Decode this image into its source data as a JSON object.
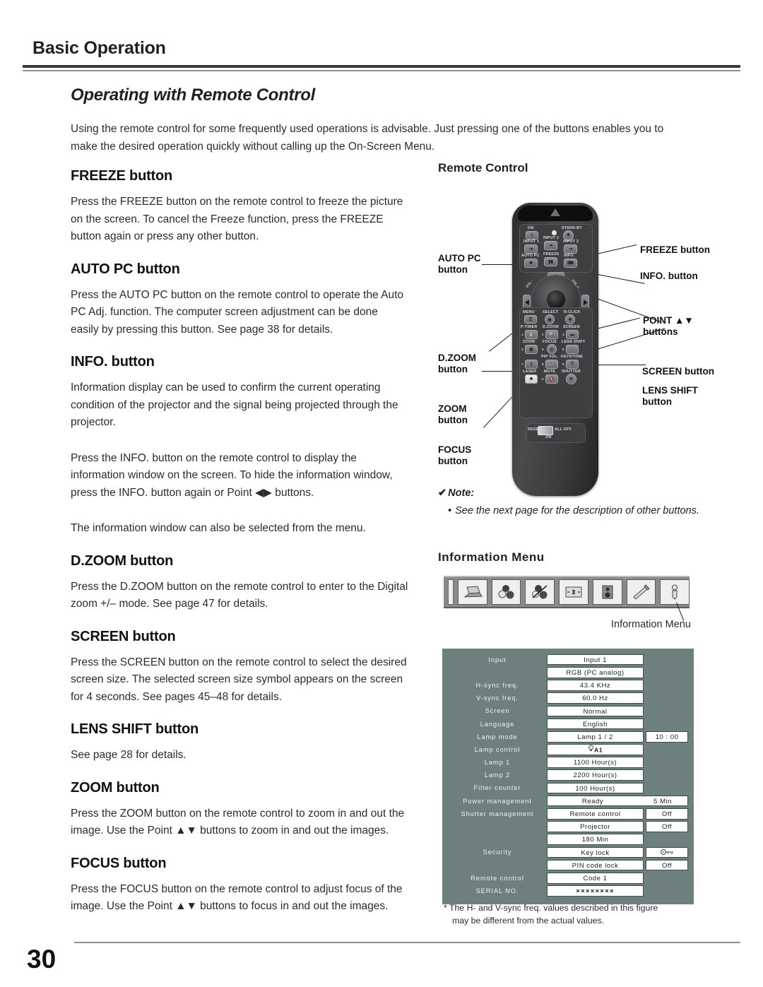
{
  "header": {
    "chapter": "Basic Operation",
    "section_title": "Operating with Remote Control",
    "intro": "Using the remote control for some frequently used operations is advisable. Just pressing one of the buttons enables you to make the desired operation quickly without calling up the On-Screen Menu."
  },
  "left_sections": [
    {
      "heading": "FREEZE button",
      "paragraphs": [
        "Press the FREEZE button on the remote control to freeze the picture on the screen. To cancel the Freeze function, press the FREEZE button again or press any other button."
      ]
    },
    {
      "heading": "AUTO PC button",
      "paragraphs": [
        "Press the AUTO PC button on the remote control to operate the Auto PC Adj. function. The computer screen adjustment can be done easily by pressing this button. See page 38 for details."
      ]
    },
    {
      "heading": "INFO. button",
      "paragraphs": [
        "Information display can be used to confirm the current operating condition of the projector and the signal being projected through the projector.",
        "Press the INFO. button on the remote control to display the information window on the screen. To hide the information window, press the INFO. button again or Point ◀▶ buttons.",
        "The information window can also be selected from the menu."
      ]
    },
    {
      "heading": "D.ZOOM button",
      "paragraphs": [
        "Press the D.ZOOM button on the remote control to enter to the Digital zoom +/– mode. See page 47 for details."
      ]
    },
    {
      "heading": "SCREEN button",
      "paragraphs": [
        "Press the SCREEN button on the remote control to select the desired screen size. The selected screen size symbol appears on the screen for 4 seconds. See pages 45–48 for details."
      ]
    },
    {
      "heading": "LENS SHIFT button",
      "paragraphs": [
        "See page 28 for details."
      ]
    },
    {
      "heading": "ZOOM button",
      "paragraphs": [
        "Press the ZOOM button on the remote control to zoom in and out the image. Use the Point ▲▼ buttons to zoom in and out the images."
      ]
    },
    {
      "heading": "FOCUS button",
      "paragraphs": [
        "Press the FOCUS button on the remote control to adjust focus of the image. Use the Point ▲▼ buttons to focus in and out the images."
      ]
    }
  ],
  "remote": {
    "title": "Remote Control",
    "callouts_left": [
      {
        "name": "auto-pc",
        "line1": "AUTO PC",
        "line2": "button"
      },
      {
        "name": "dzoom",
        "line1": "D.ZOOM",
        "line2": "button"
      },
      {
        "name": "zoom",
        "line1": "ZOOM",
        "line2": "button"
      },
      {
        "name": "focus",
        "line1": "FOCUS",
        "line2": "button"
      }
    ],
    "callouts_right": [
      {
        "name": "freeze",
        "line1": "FREEZE button",
        "line2": ""
      },
      {
        "name": "info",
        "line1": "INFO. button",
        "line2": ""
      },
      {
        "name": "point",
        "line1": "POINT ▲▼",
        "line2": "buttons"
      },
      {
        "name": "screen",
        "line1": "SCREEN button",
        "line2": ""
      },
      {
        "name": "lens-shift",
        "line1": "LENS SHIFT",
        "line2": "button"
      }
    ],
    "keys": {
      "on": "ON",
      "standby": "STAND-BY",
      "input1": "INPUT 1",
      "input2": "INPUT 2",
      "input3": "INPUT 3",
      "auto_pc": "AUTO PC",
      "freeze": "FREEZE",
      "info": "INFO.",
      "vol_minus": "VOL -",
      "vol_plus": "VOL +",
      "menu": "MENU",
      "select": "SELECT",
      "r_click": "R-CLICK",
      "p_timer": "P-TIMER",
      "d_zoom": "D.ZOOM",
      "screen": "SCREEN",
      "zoom": "ZOOM",
      "focus": "FOCUS",
      "lens_shift": "LENS SHIFT",
      "pip_vol": "PIP VOL.",
      "keystone": "KEYSTONE",
      "laser": "LASER",
      "mute": "MUTE",
      "shutter": "SHUTTER",
      "reset": "RESET",
      "all_off": "ALL OFF",
      "switch_on": "ON",
      "n1": "1",
      "n2": "2",
      "n3": "3",
      "n4": "4",
      "n5": "5",
      "n6": "6",
      "n7": "7",
      "n8": "8",
      "n9": "9",
      "n0": "0"
    }
  },
  "note": {
    "check": "✔",
    "heading": "Note:",
    "bullet": "•",
    "text": "See the next page for the description of other buttons."
  },
  "information_menu": {
    "title": "Information  Menu",
    "caption": "Information Menu",
    "icons": [
      "computer-icon",
      "image-adjust-icon",
      "image-select-icon",
      "screen-icon",
      "sound-icon",
      "setting-icon",
      "information-icon"
    ]
  },
  "info_table": {
    "rows": [
      {
        "label": "Input",
        "value": "Input 1",
        "extra": ""
      },
      {
        "label": "",
        "value": "RGB (PC analog)",
        "extra": ""
      },
      {
        "label": "H-sync freq.",
        "value": "43.4 KHz",
        "extra": ""
      },
      {
        "label": "V-sync freq.",
        "value": "60.0 Hz",
        "extra": ""
      },
      {
        "label": "Screen",
        "value": "Normal",
        "extra": ""
      },
      {
        "label": "Language",
        "value": "English",
        "extra": ""
      },
      {
        "label": "Lamp mode",
        "value": "Lamp 1 / 2",
        "extra": "10 : 00"
      },
      {
        "label": "Lamp control",
        "value": "A1",
        "extra": "",
        "icon": "lamp-bulb-icon"
      },
      {
        "label": "Lamp 1",
        "value": "1100    Hour(s)",
        "extra": ""
      },
      {
        "label": "Lamp 2",
        "value": "2200    Hour(s)",
        "extra": ""
      },
      {
        "label": "Filter counter",
        "value": "100    Hour(s)",
        "extra": ""
      },
      {
        "label": "Power management",
        "value": "Ready",
        "extra": "",
        "value_b": "5 Min",
        "split": true
      },
      {
        "label": "Shutter management",
        "value": "Remote control",
        "extra": "Off"
      },
      {
        "label": "",
        "value": "Projector",
        "extra": "Off"
      },
      {
        "label": "",
        "value": "180      Min",
        "extra": ""
      },
      {
        "label": "Security",
        "value": "Key lock",
        "extra": "",
        "extra_icon": "key-lock-icon"
      },
      {
        "label": "",
        "value": "PIN code lock",
        "extra": "Off"
      },
      {
        "label": "Remote control",
        "value": "Code 1",
        "extra": ""
      },
      {
        "label": "SERIAL NO.",
        "value": "××××××××",
        "extra": ""
      }
    ]
  },
  "footnote": {
    "line1": "* The H- and V-sync freq. values described in this figure",
    "line2": "may be different from the actual values."
  },
  "footer": {
    "page_number": "30"
  },
  "colors": {
    "rule_dark": "#3a3a3a",
    "rule_light": "#8d8d8d",
    "menu_bg": "#6d807e",
    "remote_body": "#3d3d3f"
  }
}
